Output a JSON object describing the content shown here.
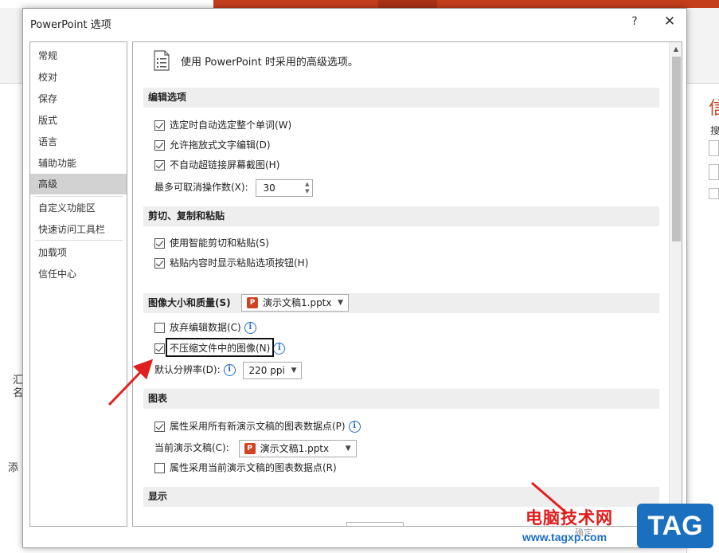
{
  "dialog": {
    "title": "PowerPoint 选项",
    "help": "?",
    "close": "✕"
  },
  "nav": {
    "items": [
      "常规",
      "校对",
      "保存",
      "版式",
      "语言",
      "辅助功能",
      "高级",
      "自定义功能区",
      "快速访问工具栏",
      "加载项",
      "信任中心"
    ],
    "selected": "高级"
  },
  "content": {
    "intro": "使用 PowerPoint 时采用的高级选项。",
    "sections": {
      "editing": {
        "header": "编辑选项",
        "opt1": "选定时自动选定整个单词(W)",
        "opt2": "允许拖放式文字编辑(D)",
        "opt3": "不自动超链接屏幕截图(H)",
        "undo_label": "最多可取消操作数(X):",
        "undo_value": "30"
      },
      "clipboard": {
        "header": "剪切、复制和粘贴",
        "opt1": "使用智能剪切和粘贴(S)",
        "opt2": "粘贴内容时显示粘贴选项按钮(H)"
      },
      "image": {
        "header": "图像大小和质量(S)",
        "file": "演示文稿1.pptx",
        "opt1": "放弃编辑数据(C)",
        "opt2": "不压缩文件中的图像(N)",
        "res_label": "默认分辨率(D):",
        "res_value": "220 ppi"
      },
      "chart": {
        "header": "图表",
        "opt1": "属性采用所有新演示文稿的图表数据点(P)",
        "current_label": "当前演示文稿(C):",
        "current_file": "演示文稿1.pptx",
        "opt2": "属性采用当前演示文稿的图表数据点(R)"
      },
      "display": {
        "header": "显示"
      }
    }
  },
  "background": {
    "right_title_char": "信",
    "right_small_char": "搜",
    "left_chars": [
      "汇",
      "名",
      "添"
    ]
  },
  "watermark": {
    "text": "电脑技术网",
    "url": "www.tagxp.com",
    "logo": "TAG",
    "ok_hint": "确定"
  },
  "colors": {
    "accent_red": "#c43e1c",
    "arrow_red": "#e02020",
    "info_blue": "#1f6fc5"
  }
}
